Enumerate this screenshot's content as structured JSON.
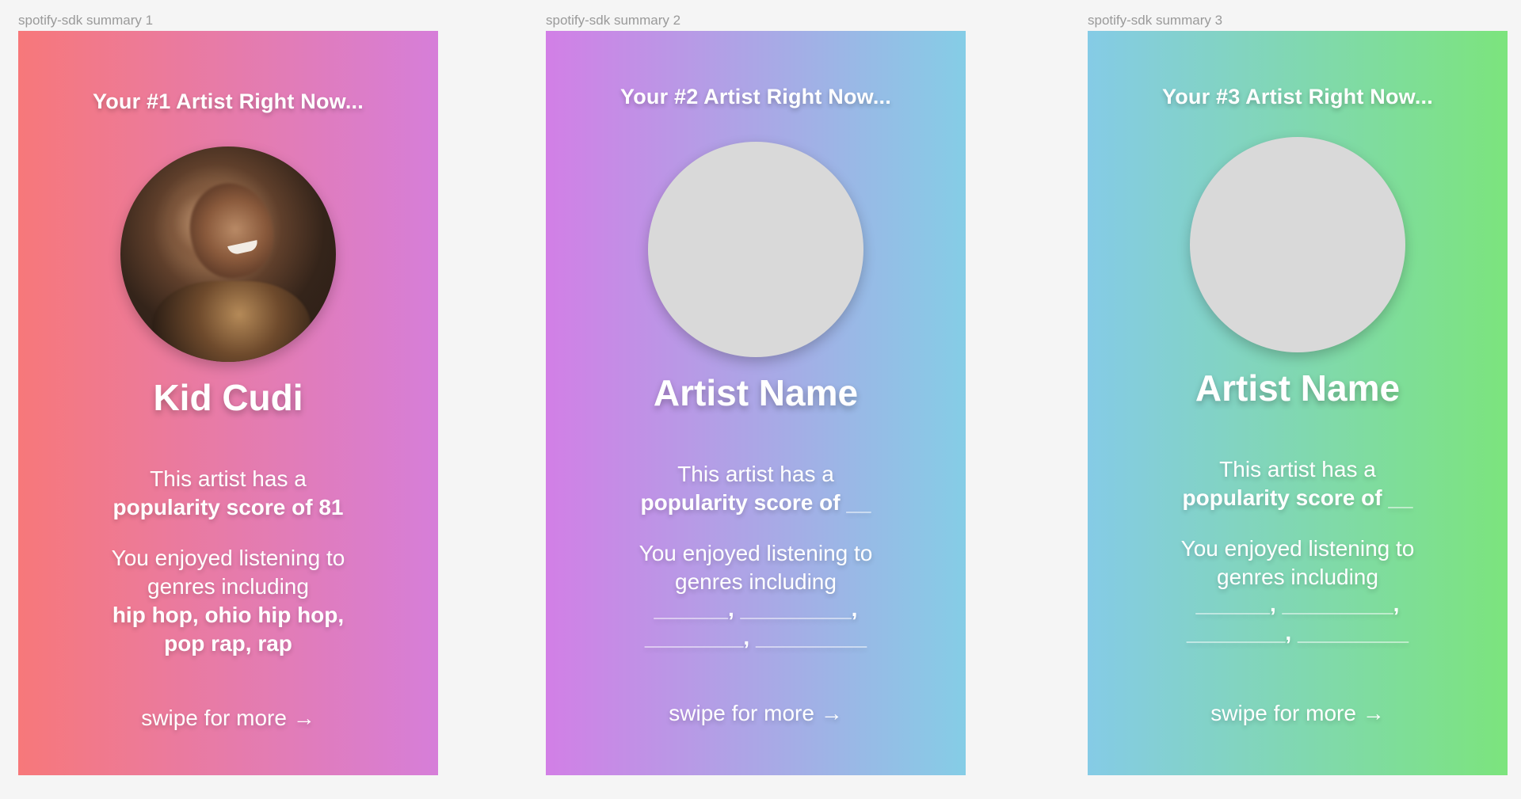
{
  "frames": [
    {
      "label": "spotify-sdk summary 1",
      "heading": "Your #1 Artist Right Now...",
      "artist_name": "Kid Cudi",
      "avatar_kind": "photo",
      "popularity_intro": "This artist has a",
      "popularity_value": "popularity score of 81",
      "genres_intro_1": "You enjoyed listening to",
      "genres_intro_2": "genres including",
      "genres_1": "hip hop, ohio hip hop,",
      "genres_2": "pop rap, rap",
      "swipe": "swipe for more →"
    },
    {
      "label": "spotify-sdk summary 2",
      "heading": "Your #2 Artist Right Now...",
      "artist_name": "Artist Name",
      "avatar_kind": "placeholder",
      "popularity_intro": "This artist has a",
      "popularity_value": "popularity score of __",
      "genres_intro_1": "You enjoyed listening to",
      "genres_intro_2": "genres including",
      "genres_1": "______, _________,",
      "genres_2": "________, _________",
      "swipe": "swipe for more →"
    },
    {
      "label": "spotify-sdk summary 3",
      "heading": "Your #3 Artist Right Now...",
      "artist_name": "Artist Name",
      "avatar_kind": "placeholder",
      "popularity_intro": "This artist has a",
      "popularity_value": "popularity score of __",
      "genres_intro_1": "You enjoyed listening to",
      "genres_intro_2": "genres including",
      "genres_1": "______, _________,",
      "genres_2": "________, _________",
      "swipe": "swipe for more →"
    }
  ],
  "colors": {
    "canvas_bg": "#f5f5f5",
    "frame1_gradient": [
      "#f7787a",
      "#d67ed9"
    ],
    "frame2_gradient": [
      "#d27fe6",
      "#85cde6"
    ],
    "frame3_gradient": [
      "#85cbe6",
      "#7ce47d"
    ],
    "placeholder_avatar": "#d9d9d9",
    "text": "#ffffff",
    "frame_label": "#9a9a9a"
  }
}
